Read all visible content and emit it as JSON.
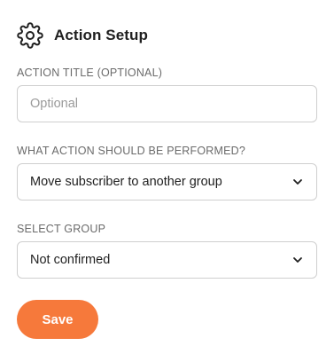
{
  "header": {
    "title": "Action Setup",
    "icon": "gear-icon"
  },
  "action_title": {
    "label": "ACTION TITLE (OPTIONAL)",
    "value": "",
    "placeholder": "Optional"
  },
  "action_type": {
    "label": "WHAT ACTION SHOULD BE PERFORMED?",
    "selected": "Move subscriber to another group",
    "icon": "chevron-down-icon"
  },
  "group": {
    "label": "SELECT GROUP",
    "selected": "Not confirmed",
    "icon": "chevron-down-icon"
  },
  "actions": {
    "save_label": "Save"
  },
  "colors": {
    "accent": "#f6793b",
    "border": "#cfcfcf",
    "label": "#6b6b6b"
  }
}
